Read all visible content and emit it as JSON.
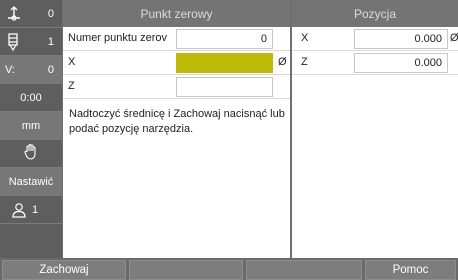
{
  "sidebar": {
    "items": [
      {
        "icon": "datum-axis-icon",
        "value": "0"
      },
      {
        "icon": "tool-icon",
        "value": "1"
      },
      {
        "label": "V:",
        "value": "0"
      },
      {
        "label": "0:00"
      },
      {
        "label": "mm"
      },
      {
        "icon": "hand-icon"
      },
      {
        "label": "Nastawić"
      },
      {
        "icon": "user-icon",
        "value": "1"
      }
    ]
  },
  "left_panel": {
    "title": "Punkt zerowy",
    "rows": [
      {
        "label": "Numer punktu zerov",
        "value": "0",
        "suffix": ""
      },
      {
        "label": "X",
        "value": "",
        "suffix": "Ø"
      },
      {
        "label": "Z",
        "value": "",
        "suffix": ""
      }
    ],
    "message": "Nadtoczyć średnicę i Zachowaj nacisnąć lub podać pozycję narzędzia."
  },
  "right_panel": {
    "title": "Pozycja",
    "rows": [
      {
        "axis": "X",
        "value": "0.000",
        "suffix": "Ø"
      },
      {
        "axis": "Z",
        "value": "0.000",
        "suffix": ""
      }
    ]
  },
  "softkeys": {
    "labels": [
      "Zachowaj",
      "",
      "",
      "",
      "Pomoc"
    ]
  },
  "colors": {
    "active_field": "#bfba09",
    "header_bg": "#747474",
    "sidebar_bg": "#5e5e5e"
  }
}
